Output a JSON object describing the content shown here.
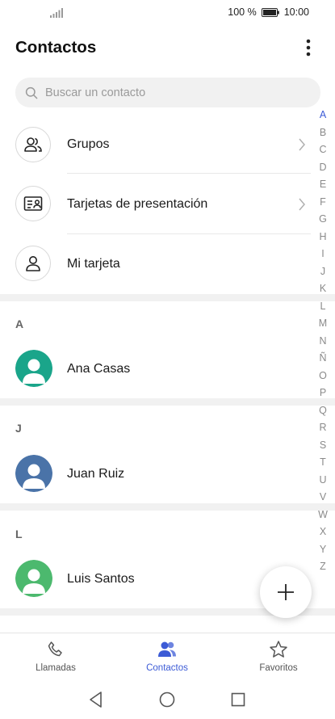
{
  "status_bar": {
    "battery_percent": "100 %",
    "time": "10:00"
  },
  "header": {
    "title": "Contactos",
    "more_icon": "more-vertical-icon"
  },
  "search": {
    "placeholder": "Buscar un contacto"
  },
  "index_letters": [
    "A",
    "B",
    "C",
    "D",
    "E",
    "F",
    "G",
    "H",
    "I",
    "J",
    "K",
    "L",
    "M",
    "N",
    "Ñ",
    "O",
    "P",
    "Q",
    "R",
    "S",
    "T",
    "U",
    "V",
    "W",
    "X",
    "Y",
    "Z"
  ],
  "shortcuts": [
    {
      "label": "Grupos",
      "icon": "group-icon"
    },
    {
      "label": "Tarjetas de presentación",
      "icon": "business-card-icon"
    },
    {
      "label": "Mi tarjeta",
      "icon": "person-icon"
    }
  ],
  "sections": [
    {
      "letter": "A",
      "contact": {
        "name": "Ana Casas",
        "color": "#1aa58a"
      }
    },
    {
      "letter": "J",
      "contact": {
        "name": "Juan Ruiz",
        "color": "#4a73a8"
      }
    },
    {
      "letter": "L",
      "contact": {
        "name": "Luis Santos",
        "color": "#4cb96e"
      }
    }
  ],
  "bottom_nav": [
    {
      "label": "Llamadas",
      "icon": "phone-icon",
      "active": false
    },
    {
      "label": "Contactos",
      "icon": "contacts-icon",
      "active": true
    },
    {
      "label": "Favoritos",
      "icon": "star-icon",
      "active": false
    }
  ],
  "colors": {
    "accent": "#3c5bd6",
    "section_bg": "#f1f1f1"
  }
}
